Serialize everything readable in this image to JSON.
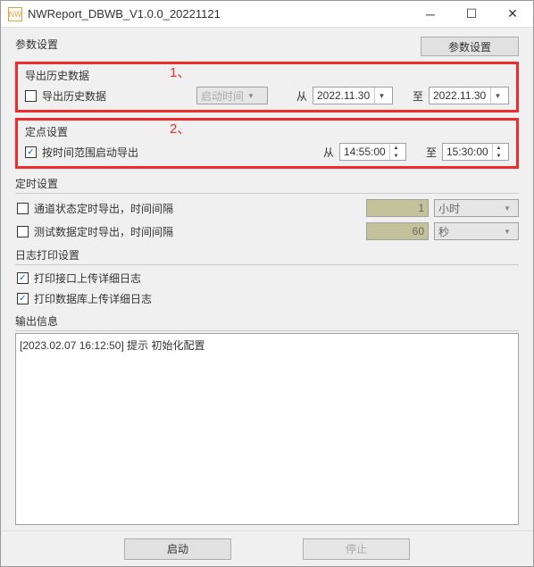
{
  "window": {
    "title": "NWReport_DBWB_V1.0.0_20221121"
  },
  "param_header": {
    "label": "参数设置",
    "button": "参数设置"
  },
  "annotations": {
    "a1": "1、",
    "a2": "2、"
  },
  "export_history": {
    "title": "导出历史数据",
    "checkbox_label": "导出历史数据",
    "combo_value": "启动时间",
    "from_label": "从",
    "from_date": "2022.11.30",
    "to_label": "至",
    "to_date": "2022.11.30"
  },
  "fixed_point": {
    "title": "定点设置",
    "checkbox_label": "按时间范围启动导出",
    "from_label": "从",
    "from_time": "14:55:00",
    "to_label": "至",
    "to_time": "15:30:00"
  },
  "timer": {
    "title": "定时设置",
    "channel_label": "通道状态定时导出，时间间隔",
    "channel_value": "1",
    "channel_unit": "小时",
    "test_label": "测试数据定时导出，时间间隔",
    "test_value": "60",
    "test_unit": "秒"
  },
  "log": {
    "title": "日志打印设置",
    "api_label": "打印接口上传详细日志",
    "db_label": "打印数据库上传详细日志"
  },
  "output": {
    "title": "输出信息",
    "content": "[2023.02.07 16:12:50] 提示 初始化配置"
  },
  "footer": {
    "start": "启动",
    "stop": "停止"
  }
}
